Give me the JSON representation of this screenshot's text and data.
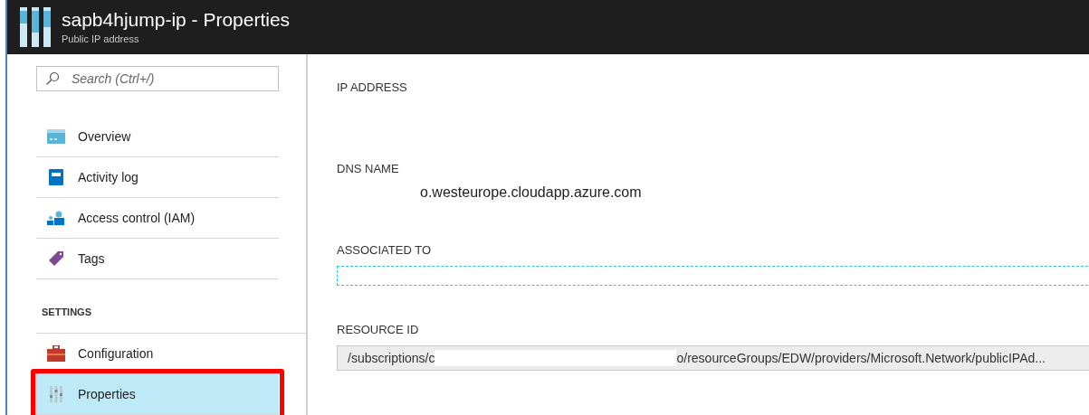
{
  "header": {
    "title": "sapb4hjump-ip - Properties",
    "subtitle": "Public IP address"
  },
  "sidebar": {
    "search": {
      "placeholder": "Search (Ctrl+/)"
    },
    "items": [
      {
        "label": "Overview",
        "selected": false
      },
      {
        "label": "Activity log",
        "selected": false
      },
      {
        "label": "Access control (IAM)",
        "selected": false
      },
      {
        "label": "Tags",
        "selected": false
      }
    ],
    "section": "SETTINGS",
    "settings_items": [
      {
        "label": "Configuration",
        "selected": false
      },
      {
        "label": "Properties",
        "selected": true,
        "highlighted": true
      }
    ]
  },
  "properties": [
    {
      "label": "IP ADDRESS",
      "kind": "empty"
    },
    {
      "label": "DNS NAME",
      "kind": "text",
      "value": "o.westeurope.cloudapp.azure.com"
    },
    {
      "label": "ASSOCIATED TO",
      "kind": "link"
    },
    {
      "label": "RESOURCE ID",
      "kind": "field",
      "value_start": "/subscriptions/c",
      "value_end": "o/resourceGroups/EDW/providers/Microsoft.Network/publicIPAd..."
    }
  ]
}
